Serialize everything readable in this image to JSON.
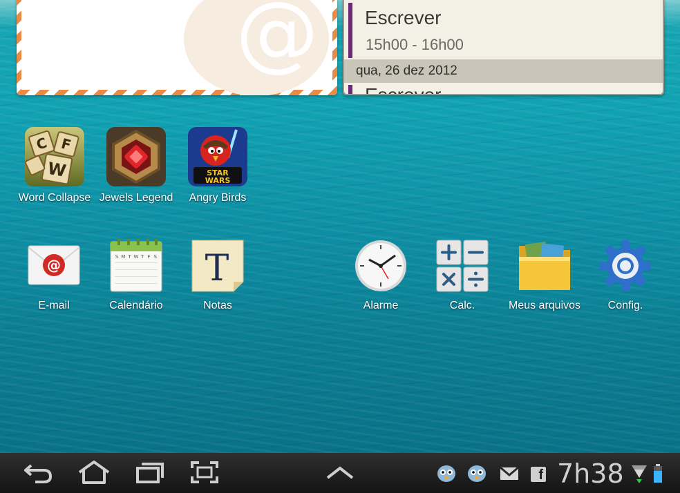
{
  "email_widget": {
    "symbol": "@"
  },
  "calendar_widget": {
    "event_title": "Escrever",
    "event_time": "15h00 - 16h00",
    "date": "qua, 26 dez 2012",
    "next_event_title": "Escrever"
  },
  "apps_row1": [
    {
      "label": "Word Collapse",
      "icon": "word-collapse-icon"
    },
    {
      "label": "Jewels Legend",
      "icon": "jewels-legend-icon"
    },
    {
      "label": "Angry Birds",
      "icon": "angry-birds-star-wars-icon"
    }
  ],
  "apps_row2": [
    {
      "label": "E-mail",
      "icon": "email-icon"
    },
    {
      "label": "Calendário",
      "icon": "calendar-icon"
    },
    {
      "label": "Notas",
      "icon": "notes-icon"
    },
    {
      "label": "Alarme",
      "icon": "alarm-clock-icon"
    },
    {
      "label": "Calc.",
      "icon": "calculator-icon"
    },
    {
      "label": "Meus arquivos",
      "icon": "folder-icon"
    },
    {
      "label": "Config.",
      "icon": "settings-gear-icon"
    }
  ],
  "calendar_icon_days": [
    "S",
    "M",
    "T",
    "W",
    "T",
    "F",
    "S"
  ],
  "notes_icon_letter": "T",
  "status_bar": {
    "clock": "7h38",
    "facebook_letter": "f"
  },
  "colors": {
    "event_accent": "#6e2a79",
    "envelope_stripe": "#e98a46",
    "sea": "#11a3b3"
  }
}
